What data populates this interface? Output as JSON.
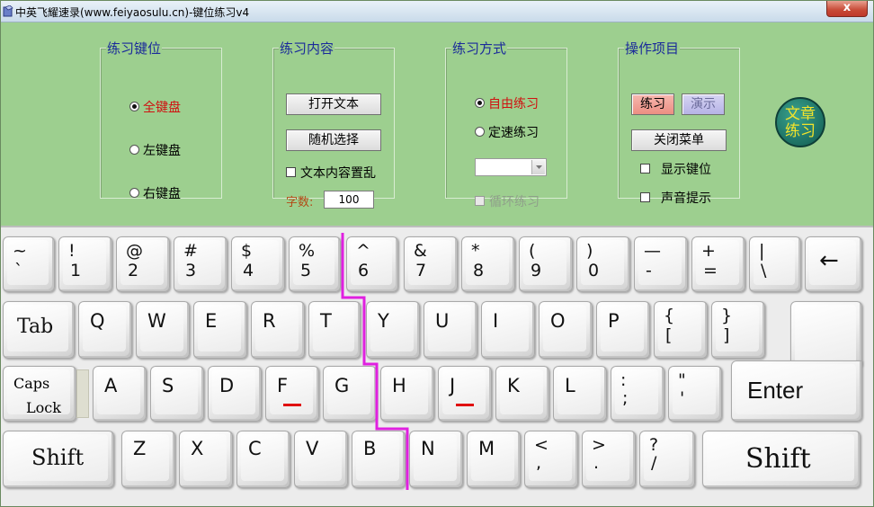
{
  "window": {
    "title": "中英飞耀速录(www.feiyaosulu.cn)-键位练习v4",
    "close_label": "x"
  },
  "groups": {
    "keys_range": {
      "title": "练习键位",
      "options": [
        "全键盘",
        "左键盘",
        "右键盘"
      ],
      "selected": "全键盘"
    },
    "content": {
      "title": "练习内容",
      "open_text": "打开文本",
      "random_select": "随机选择",
      "shuffle_label": "文本内容置乱",
      "count_label": "字数:",
      "count_value": "100"
    },
    "mode": {
      "title": "练习方式",
      "options": [
        "自由练习",
        "定速练习"
      ],
      "selected": "自由练习",
      "speed_value": "",
      "loop_label": "循环练习"
    },
    "actions": {
      "title": "操作项目",
      "practice": "练习",
      "demo": "演示",
      "close_menu": "关闭菜单",
      "show_keys": "显示键位",
      "sound_hint": "声音提示"
    }
  },
  "article_badge": {
    "line1": "文章",
    "line2": "练习"
  },
  "keyboard": {
    "row1": [
      {
        "top": "~",
        "bot": "`"
      },
      {
        "top": "!",
        "bot": "1"
      },
      {
        "top": "@",
        "bot": "2"
      },
      {
        "top": "#",
        "bot": "3"
      },
      {
        "top": "$",
        "bot": "4"
      },
      {
        "top": "%",
        "bot": "5"
      },
      {
        "top": "^",
        "bot": "6"
      },
      {
        "top": "&",
        "bot": "7"
      },
      {
        "top": "*",
        "bot": "8"
      },
      {
        "top": "(",
        "bot": "9"
      },
      {
        "top": ")",
        "bot": "0"
      },
      {
        "top": "—",
        "bot": "-"
      },
      {
        "top": "+",
        "bot": "="
      },
      {
        "top": "|",
        "bot": "\\"
      }
    ],
    "backspace": "←",
    "tab": "Tab",
    "row2": [
      "Q",
      "W",
      "E",
      "R",
      "T",
      "Y",
      "U",
      "I",
      "O",
      "P"
    ],
    "row2_brackets": [
      {
        "top": "{",
        "bot": "["
      },
      {
        "top": "}",
        "bot": "]"
      }
    ],
    "caps_top": "Caps",
    "caps_bot": "Lock",
    "row3": [
      "A",
      "S",
      "D",
      "F",
      "G",
      "H",
      "J",
      "K",
      "L"
    ],
    "row3_punct": [
      {
        "top": ":",
        "bot": ";"
      },
      {
        "top": "\"",
        "bot": "'"
      }
    ],
    "enter": "Enter",
    "shift_left": "Shift",
    "row4": [
      "Z",
      "X",
      "C",
      "V",
      "B",
      "N",
      "M"
    ],
    "row4_punct": [
      {
        "top": "<",
        "bot": ","
      },
      {
        "top": ">",
        "bot": "."
      },
      {
        "top": "?",
        "bot": "/"
      }
    ],
    "shift_right": "Shift",
    "divider_color": "#e020e0",
    "home_marker_color": "#e01010"
  }
}
